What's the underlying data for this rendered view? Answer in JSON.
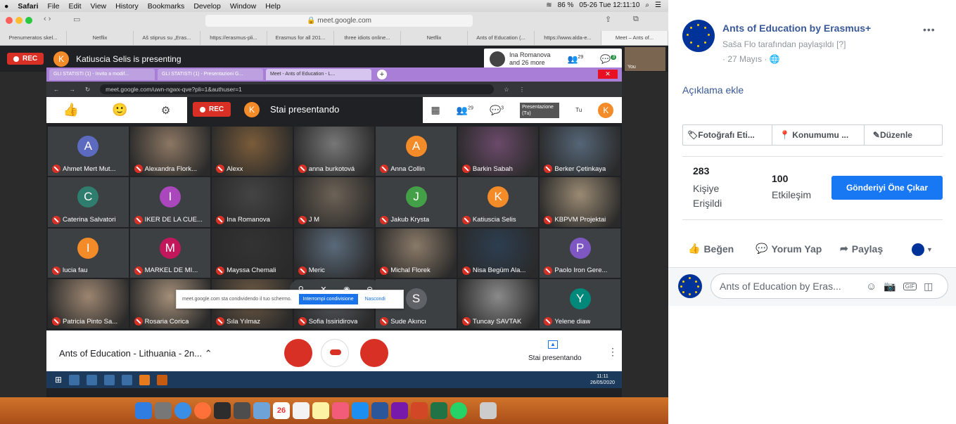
{
  "mac": {
    "apple": "●",
    "menu": [
      "Safari",
      "File",
      "Edit",
      "View",
      "History",
      "Bookmarks",
      "Develop",
      "Window",
      "Help"
    ],
    "battery": "86 %",
    "datetime": "05-26 Tue  12:11:10"
  },
  "safari": {
    "address": "meet.google.com",
    "tabs": [
      "Prenumeratos skel...",
      "Netflix",
      "Aš stiprus su „Eras...",
      "https://erasmus-pli...",
      "Erasmus for all 201...",
      "three idiots online...",
      "Netflix",
      "Ants of Education (...",
      "https://www.alda-e...",
      "Meet – Ants of..."
    ]
  },
  "meet_top": {
    "rec": "REC",
    "avatar": "K",
    "presenting": "Katiuscia Selis is presenting",
    "other_user": "Ina Romanova",
    "other_more": "and 26 more",
    "people_count": "29",
    "chat_count": "3",
    "you": "You"
  },
  "inner": {
    "tabs": [
      "GLI STATISTI (1) - Invito a modif...",
      "GLI STATISTI (1) - Presentazioni G...",
      "Meet - Ants of Education - L..."
    ],
    "url": "meet.google.com/uwn-ngwx-qve?pli=1&authuser=1",
    "rec": "REC",
    "avatar": "K",
    "presenting": "Stai presentando",
    "people_count": "29",
    "chat_count": "3",
    "presentation": "Presentazione (Tu)",
    "tu": "Tu"
  },
  "participants": [
    {
      "name": "Ahmet Mert Mut...",
      "initial": "A",
      "color": "#5c6bc0",
      "photo": ""
    },
    {
      "name": "Alexandra Flork...",
      "initial": "",
      "color": "",
      "photo": "#8c7763"
    },
    {
      "name": "Alexx",
      "initial": "",
      "color": "",
      "photo": "#7a5c3a"
    },
    {
      "name": "anna burkotová",
      "initial": "",
      "color": "",
      "photo": "#777777"
    },
    {
      "name": "Anna Collin",
      "initial": "A",
      "color": "#f28b28",
      "photo": ""
    },
    {
      "name": "Barkin Sabah",
      "initial": "",
      "color": "",
      "photo": "#6b4a6a"
    },
    {
      "name": "Berker Çetinkaya",
      "initial": "",
      "color": "",
      "photo": "#556677"
    },
    {
      "name": "Caterina Salvatori",
      "initial": "C",
      "color": "#2e7d6e",
      "photo": ""
    },
    {
      "name": "IKER DE LA CUE...",
      "initial": "I",
      "color": "#ab47bc",
      "photo": ""
    },
    {
      "name": "Ina Romanova",
      "initial": "",
      "color": "",
      "photo": "#444444"
    },
    {
      "name": "J M",
      "initial": "",
      "color": "",
      "photo": "#6d6256"
    },
    {
      "name": "Jakub Krysta",
      "initial": "J",
      "color": "#43a047",
      "photo": ""
    },
    {
      "name": "Katiuscia Selis",
      "initial": "K",
      "color": "#f28b28",
      "photo": ""
    },
    {
      "name": "KBPVM Projektai",
      "initial": "",
      "color": "",
      "photo": "#9a8a73"
    },
    {
      "name": "lucia fau",
      "initial": "I",
      "color": "#f28b28",
      "photo": ""
    },
    {
      "name": "MARKEL DE MI...",
      "initial": "M",
      "color": "#c2185b",
      "photo": ""
    },
    {
      "name": "Mayssa Chemali",
      "initial": "",
      "color": "",
      "photo": "#333333"
    },
    {
      "name": "Meric",
      "initial": "",
      "color": "",
      "photo": "#5a6a7a"
    },
    {
      "name": "Michal Florek",
      "initial": "",
      "color": "",
      "photo": "#8a7a68"
    },
    {
      "name": "Nisa Begüm Ala...",
      "initial": "",
      "color": "",
      "photo": "#2c3e50"
    },
    {
      "name": "Paolo Iron Gere...",
      "initial": "P",
      "color": "#7e57c2",
      "photo": ""
    },
    {
      "name": "Patricia Pinto Sa...",
      "initial": "",
      "color": "",
      "photo": "#9c8570"
    },
    {
      "name": "Rosaria Corica",
      "initial": "",
      "color": "",
      "photo": "#a38e78"
    },
    {
      "name": "Sıla Yılmaz",
      "initial": "",
      "color": "",
      "photo": "#6e5a44"
    },
    {
      "name": "Sofia Issiridirova",
      "initial": "",
      "color": "",
      "photo": "#555a60"
    },
    {
      "name": "Sude Akıncı",
      "initial": "S",
      "color": "#5f6368",
      "photo": ""
    },
    {
      "name": "Tuncay SAVTAK",
      "initial": "",
      "color": "",
      "photo": "#8a8a8a"
    },
    {
      "name": "Yelene diaw",
      "initial": "Y",
      "color": "#00897b",
      "photo": ""
    }
  ],
  "meet_bottom": {
    "meeting_title": "Ants of Education - Lithuania - 2n...",
    "present_label": "Stai presentando"
  },
  "share_notice": {
    "text": "meet.google.com sta condividendo il tuo schermo.",
    "stop": "Interrompi condivisione",
    "hide": "Nascondi"
  },
  "taskbar": {
    "time": "11:11",
    "date": "26/05/2020"
  },
  "dock_date": "26",
  "fb": {
    "page_name": "Ants of Education by Erasmus+",
    "shared_by": "Saša Flo tarafından paylaşıldı [?]",
    "date": "· 27 Mayıs · ",
    "more": "•••",
    "add_description": "Açıklama ekle",
    "actions": [
      "Fotoğrafı Eti...",
      "Konumumu ...",
      "Düzenle"
    ],
    "reach_num": "283",
    "reach_label": "Kişiye Erişildi",
    "engage_num": "100",
    "engage_label": "Etkileşim",
    "boost": "Gönderiyi Öne Çıkar",
    "like": "Beğen",
    "comment": "Yorum Yap",
    "share": "Paylaş",
    "comment_placeholder": "Ants of Education by Eras..."
  },
  "colors": {
    "fb_blue": "#1877f2",
    "link_blue": "#385898",
    "rec_red": "#d93025",
    "meet_dark": "#202124"
  }
}
